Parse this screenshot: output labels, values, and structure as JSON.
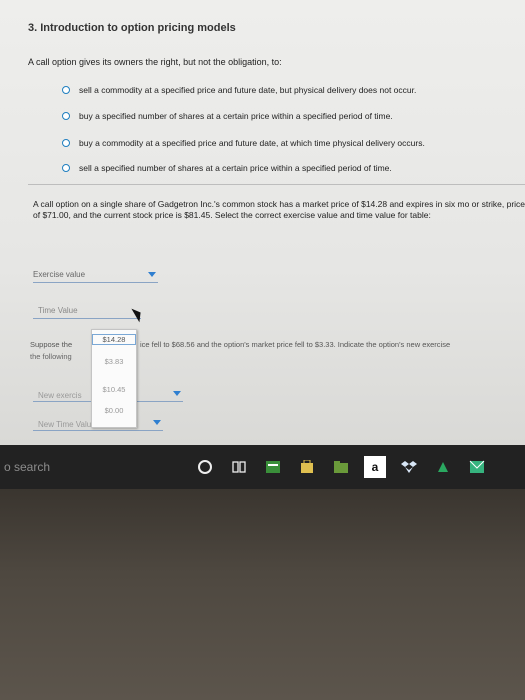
{
  "section": {
    "title": "3. Introduction to option pricing models"
  },
  "q1": {
    "prompt": "A call option gives its owners the right, but not the obligation, to:",
    "options": [
      "sell a commodity at a specified price and future date, but physical delivery does not occur.",
      "buy a specified number of shares at a certain price within a specified period of time.",
      "buy a commodity at a specified price and future date, at which time physical delivery occurs.",
      "sell a specified number of shares at a certain price within a specified period of time."
    ]
  },
  "q2": {
    "text": "A call option on a single share of Gadgetron Inc.'s common stock has a market price of $14.28 and expires in six mo or strike, price of $71.00, and the current stock price is $81.45. Select the correct exercise value and time value for table:",
    "exercise_label": "Exercise value",
    "time_label": "Time Value",
    "para3_left": "Suppose the",
    "para3_right": "ice fell to $68.56 and the option's market price fell to $3.33. Indicate the option's new exercise",
    "para3b": "the following",
    "new_exercise_label": "New exercis",
    "new_time_label": "New Time Value",
    "dropdown_options": [
      "$14.28",
      "$3.83",
      "$10.45",
      "$0.00"
    ]
  },
  "taskbar": {
    "search_placeholder": "o search",
    "icons": [
      "cortana-icon",
      "task-view-icon",
      "file-explorer-icon",
      "store-icon",
      "folder-icon",
      "amazon-icon",
      "dropbox-icon",
      "money-icon",
      "mail-icon"
    ],
    "amazon_letter": "a"
  },
  "colors": {
    "accent": "#1f7fc0",
    "screen_bg": "#eeeeec",
    "taskbar_bg": "#222222"
  }
}
